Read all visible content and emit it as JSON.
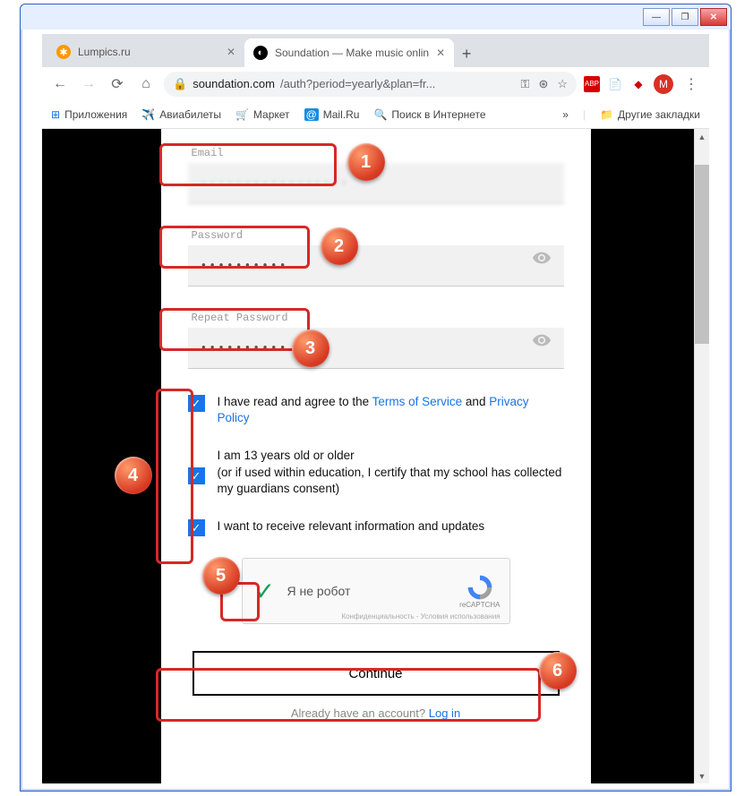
{
  "chrome": {
    "tabs": [
      {
        "title": "Lumpics.ru",
        "active": false
      },
      {
        "title": "Soundation — Make music onlin",
        "active": true
      }
    ],
    "url_prefix": "soundation.com",
    "url_rest": "/auth?period=yearly&plan=fr...",
    "avatar_letter": "M",
    "bookmarks": {
      "apps": "Приложения",
      "avia": "Авиабилеты",
      "market": "Маркет",
      "mail": "Mail.Ru",
      "search": "Поиск в Интернете",
      "other": "Другие закладки"
    }
  },
  "form": {
    "email_label": "Email",
    "email_value": "•••••••••••••••••",
    "password_label": "Password",
    "password_value": "••••••••••",
    "repeat_label": "Repeat Password",
    "repeat_value": "••••••••••",
    "checks": {
      "tos_pre": "I have read and agree to the ",
      "tos_link": "Terms of Service",
      "tos_mid": " and ",
      "privacy_link": "Privacy Policy",
      "age_line1": "I am 13 years old or older",
      "age_line2": "(or if used within education, I certify that my school has collected my guardians consent)",
      "updates": "I want to receive relevant information and updates"
    },
    "recaptcha": {
      "label": "Я не робот",
      "brand": "reCAPTCHA",
      "privacy": "Конфиденциальность - Условия использования"
    },
    "continue": "Continue",
    "already": "Already have an account? ",
    "login": "Log in"
  },
  "badges": {
    "1": "1",
    "2": "2",
    "3": "3",
    "4": "4",
    "5": "5",
    "6": "6"
  }
}
